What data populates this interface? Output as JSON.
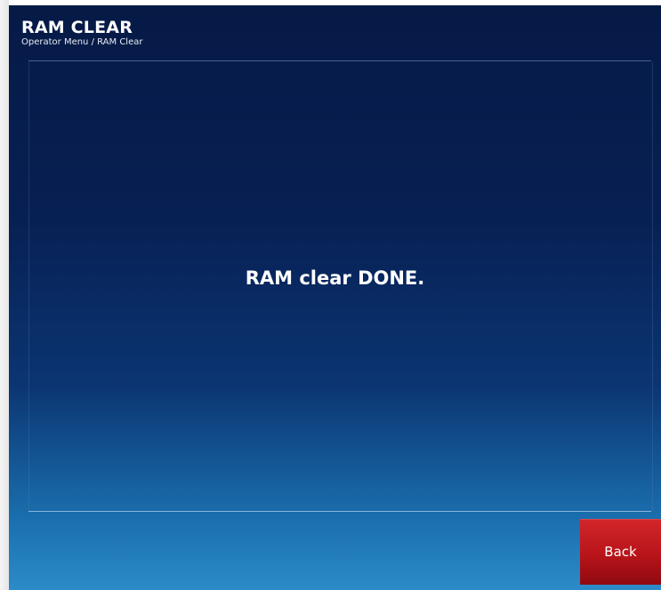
{
  "header": {
    "title": "RAM CLEAR",
    "breadcrumb": "Operator Menu / RAM Clear"
  },
  "main": {
    "message": "RAM clear DONE."
  },
  "footer": {
    "back_label": "Back"
  },
  "colors": {
    "background_top": "#061a46",
    "background_bottom": "#2c8bc8",
    "back_button": "#b8141a",
    "text": "#ffffff"
  }
}
